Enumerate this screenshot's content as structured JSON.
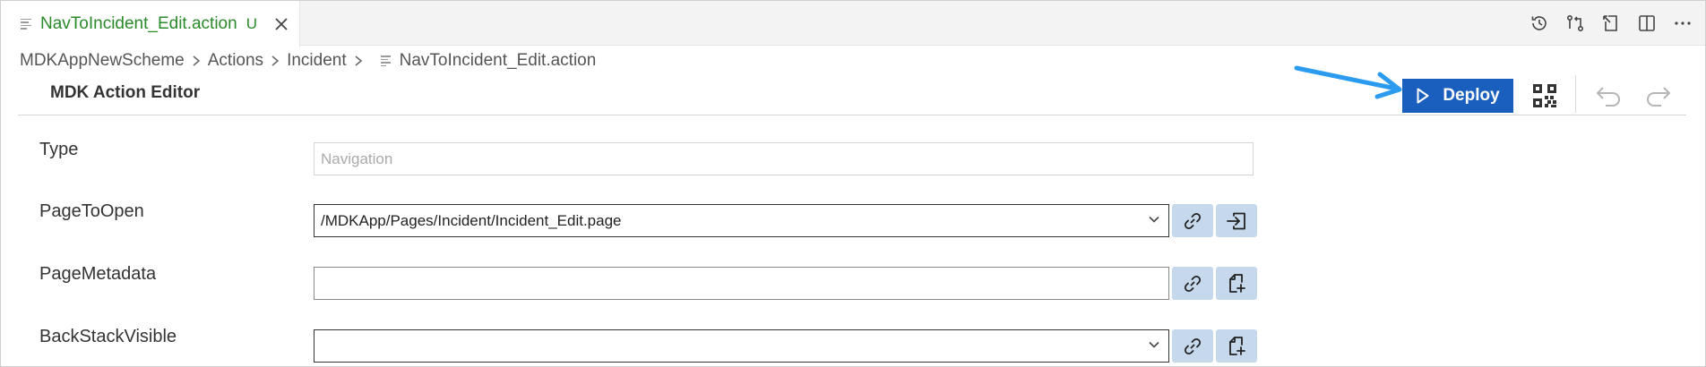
{
  "tab": {
    "title": "NavToIncident_Edit.action",
    "status": "U",
    "icon": "file-lines-icon"
  },
  "tab_actions": [
    "history-icon",
    "compare-changes-icon",
    "open-file-icon",
    "split-editor-icon",
    "more-actions-icon"
  ],
  "breadcrumb": {
    "items": [
      "MDKAppNewScheme",
      "Actions",
      "Incident"
    ],
    "file": "NavToIncident_Edit.action"
  },
  "editor": {
    "title": "MDK Action Editor"
  },
  "toolbar": {
    "deploy_label": "Deploy",
    "accent": "#1a5fbe",
    "annotation_arrow_color": "#2b9bf0"
  },
  "form": {
    "type": {
      "label": "Type",
      "placeholder": "Navigation"
    },
    "page_to_open": {
      "label": "PageToOpen",
      "value": "/MDKApp/Pages/Incident/Incident_Edit.page"
    },
    "page_metadata": {
      "label": "PageMetadata",
      "value": ""
    },
    "back_stack_visible": {
      "label": "BackStackVisible",
      "value": ""
    }
  }
}
